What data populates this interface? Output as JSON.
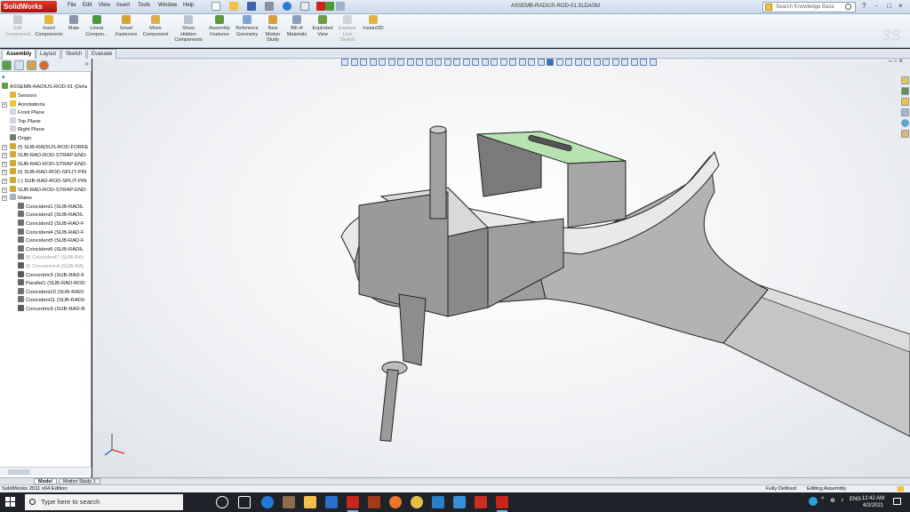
{
  "app": {
    "brand": "SolidWorks",
    "window_title": "ASSEMB-RADIUS-ROD-01.SLDASM",
    "menu": [
      "File",
      "Edit",
      "View",
      "Insert",
      "Tools",
      "Window",
      "Help"
    ],
    "search_placeholder": "Search Knowledge Base",
    "window_controls": [
      "?",
      "-",
      "□",
      "×"
    ]
  },
  "ribbon": {
    "buttons": [
      {
        "label": "Edit\nComponent",
        "disabled": true
      },
      {
        "label": "Insert\nComponents",
        "disabled": false
      },
      {
        "label": "Mate",
        "disabled": false
      },
      {
        "label": "Linear\nCompon...",
        "disabled": false
      },
      {
        "label": "Smart\nFasteners",
        "disabled": false
      },
      {
        "label": "Move\nComponent",
        "disabled": false
      },
      {
        "label": "Show\nHidden\nComponents",
        "disabled": false
      },
      {
        "label": "Assembly\nFeatures",
        "disabled": false
      },
      {
        "label": "Reference\nGeometry",
        "disabled": false
      },
      {
        "label": "New\nMotion\nStudy",
        "disabled": false
      },
      {
        "label": "Bill of\nMaterials",
        "disabled": false
      },
      {
        "label": "Exploded\nView",
        "disabled": false
      },
      {
        "label": "Explode\nLine\nSketch",
        "disabled": true
      },
      {
        "label": "Instant3D",
        "disabled": false
      }
    ],
    "command_tabs": [
      "Assembly",
      "Layout",
      "Sketch",
      "Evaluate"
    ],
    "active_tab": "Assembly"
  },
  "tree": {
    "root": "ASSEMB-RADIUS-ROD-01 (Defa",
    "items": [
      {
        "label": "Sensors",
        "icon": "sensor-icon",
        "expandable": false,
        "indent": 1
      },
      {
        "label": "Annotations",
        "icon": "annotation-icon",
        "expandable": true,
        "indent": 1
      },
      {
        "label": "Front Plane",
        "icon": "plane-icon",
        "expandable": false,
        "indent": 1
      },
      {
        "label": "Top Plane",
        "icon": "plane-icon",
        "expandable": false,
        "indent": 1
      },
      {
        "label": "Right Plane",
        "icon": "plane-icon",
        "expandable": false,
        "indent": 1
      },
      {
        "label": "Origin",
        "icon": "origin-icon",
        "expandable": false,
        "indent": 1
      },
      {
        "label": "(f) SUB-RADIUS-ROD-FORKE",
        "icon": "part-icon",
        "expandable": true,
        "indent": 1
      },
      {
        "label": "SUB-RAD-ROD-STRAP-END-",
        "icon": "part-icon",
        "expandable": true,
        "indent": 1
      },
      {
        "label": "SUB-RAD-ROD-STRAP-END-",
        "icon": "part-icon",
        "expandable": true,
        "indent": 1
      },
      {
        "label": "(f) SUB-RAD-ROD-SPLIT-PIN",
        "icon": "part-icon",
        "expandable": true,
        "indent": 1
      },
      {
        "label": "(-) SUB-RAD-ROD-SPLIT-PIN",
        "icon": "part-icon",
        "expandable": true,
        "indent": 1
      },
      {
        "label": "SUB-RAD-ROD-STRAP-END-",
        "icon": "part-icon",
        "expandable": true,
        "indent": 1
      },
      {
        "label": "Mates",
        "icon": "mates-icon",
        "expandable": true,
        "indent": 1
      },
      {
        "label": "Coincident1 (SUB-RADIL",
        "icon": "coincident-icon",
        "expandable": false,
        "indent": 2
      },
      {
        "label": "Coincident2 (SUB-RADIL",
        "icon": "coincident-icon",
        "expandable": false,
        "indent": 2
      },
      {
        "label": "Coincident3 (SUB-RAD-F",
        "icon": "coincident-icon",
        "expandable": false,
        "indent": 2
      },
      {
        "label": "Coincident4 (SUB-RAD-F",
        "icon": "coincident-icon",
        "expandable": false,
        "indent": 2
      },
      {
        "label": "Coincident5 (SUB-RAD-F",
        "icon": "coincident-icon",
        "expandable": false,
        "indent": 2
      },
      {
        "label": "Coincident6 (SUB-RADIL",
        "icon": "coincident-icon",
        "expandable": false,
        "indent": 2
      },
      {
        "label": "(f) Coincident7 (SUB-RA)",
        "icon": "coincident-icon",
        "expandable": false,
        "indent": 2,
        "suppressed": true
      },
      {
        "label": "(f) Concentric4 (SUB-RA)",
        "icon": "concentric-icon",
        "expandable": false,
        "indent": 2,
        "suppressed": true
      },
      {
        "label": "Concentric5 (SUB-RAD-F",
        "icon": "concentric-icon",
        "expandable": false,
        "indent": 2
      },
      {
        "label": "Parallel1 (SUB-RAD-ROD",
        "icon": "parallel-icon",
        "expandable": false,
        "indent": 2
      },
      {
        "label": "Coincident10 (SUB-RADI",
        "icon": "coincident-icon",
        "expandable": false,
        "indent": 2
      },
      {
        "label": "Coincident11 (SUB-RADII",
        "icon": "coincident-icon",
        "expandable": false,
        "indent": 2
      },
      {
        "label": "Concentric6 (SUB-RAD-R",
        "icon": "concentric-icon",
        "expandable": false,
        "indent": 2
      }
    ]
  },
  "bottom_tabs": [
    "Model",
    "Motion Study 1"
  ],
  "status": {
    "left": "SolidWorks 2011 x64 Edition",
    "right1": "Fully Defined",
    "right2": "Editing Assembly"
  },
  "taskbar": {
    "search_placeholder": "Type here to search",
    "time": "12:42 AM",
    "date": "4/2/2021"
  },
  "colors": {
    "face_highlight": "#b7e3b0",
    "brand_red": "#c8251b",
    "model_grey": "#a8a8a8"
  }
}
